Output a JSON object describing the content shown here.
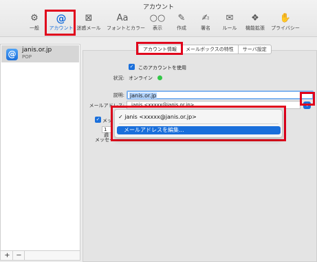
{
  "window": {
    "title": "アカウント"
  },
  "toolbar": {
    "items": [
      {
        "label": "一般",
        "icon": "gear-icon"
      },
      {
        "label": "アカウント",
        "icon": "at-icon"
      },
      {
        "label": "迷惑メール",
        "icon": "junk-icon"
      },
      {
        "label": "フォントとカラー",
        "icon": "font-icon"
      },
      {
        "label": "表示",
        "icon": "glasses-icon"
      },
      {
        "label": "作成",
        "icon": "compose-icon"
      },
      {
        "label": "署名",
        "icon": "signature-icon"
      },
      {
        "label": "ルール",
        "icon": "rules-icon"
      },
      {
        "label": "機能拡張",
        "icon": "puzzle-icon"
      },
      {
        "label": "プライバシー",
        "icon": "hand-icon"
      }
    ],
    "active_index": 1
  },
  "sidebar": {
    "accounts": [
      {
        "name": "janis.or.jp",
        "type": "POP"
      }
    ],
    "add_label": "+",
    "remove_label": "−"
  },
  "tabs": [
    "アカウント情報",
    "メールボックスの特性",
    "サーバ設定"
  ],
  "form": {
    "enable_label": "このアカウントを使用",
    "status_label": "状況:",
    "status_value": "オンライン",
    "description_label": "説明:",
    "description_value": "janis.or.jp",
    "address_label": "メールアドレス:",
    "address_value": "janis <xxxxx@janis.or.jp>",
    "check_label": "メッ",
    "port_value": "1週",
    "message_label": "メッセー"
  },
  "menu": {
    "checked_item": "✓ janis <xxxxx@janis.or.jp>",
    "selected_item": "メールアドレスを編集..."
  },
  "colors": {
    "accent": "#1a6fdb",
    "highlight_box": "#e0001b",
    "online": "#33c748"
  }
}
